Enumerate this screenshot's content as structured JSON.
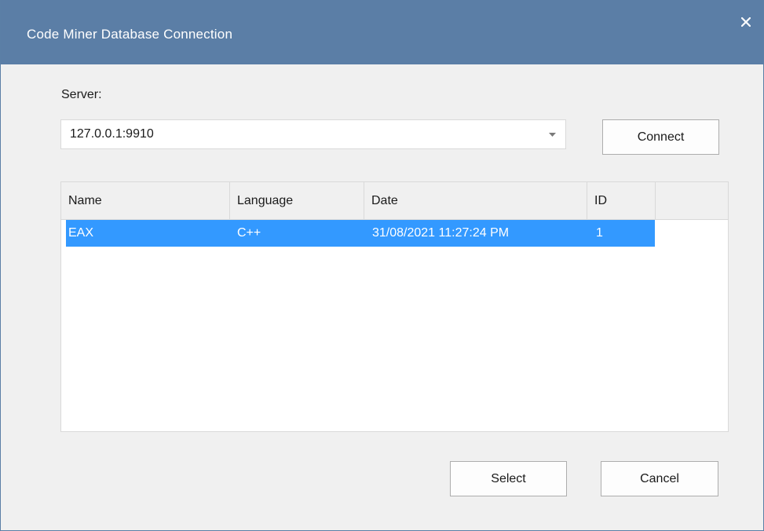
{
  "window": {
    "title": "Code Miner Database Connection",
    "close_icon": "close-icon",
    "accent": "#5b7ea6"
  },
  "server": {
    "label": "Server:",
    "value": "127.0.0.1:9910"
  },
  "buttons": {
    "connect": "Connect",
    "select": "Select",
    "cancel": "Cancel"
  },
  "table": {
    "columns": [
      "Name",
      "Language",
      "Date",
      "ID"
    ],
    "rows": [
      {
        "name": "EAX",
        "language": "C++",
        "date": "31/08/2021 11:27:24 PM",
        "id": "1",
        "selected": true
      }
    ],
    "selection_color": "#3399ff"
  }
}
